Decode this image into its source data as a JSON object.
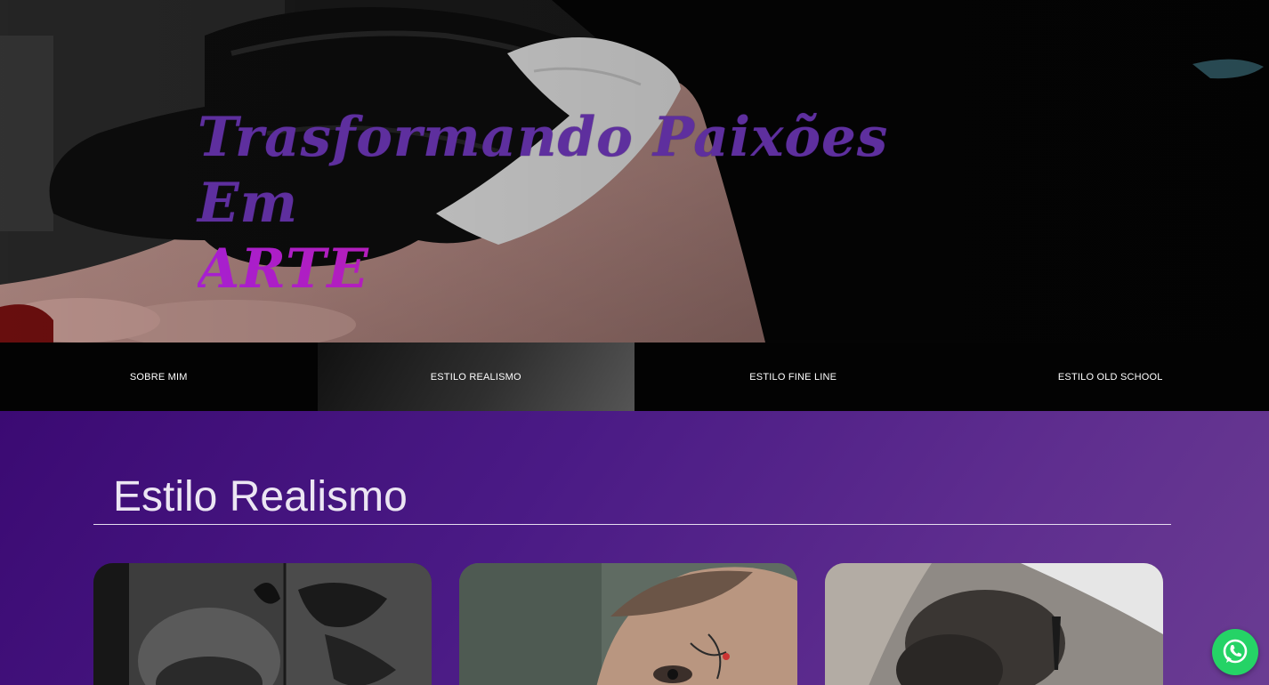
{
  "hero": {
    "title_line1": "Trasformando Paixões Em",
    "title_line2": "ARTE",
    "image": "tattoo-artist-gloved-hand-wiping-skin-photo"
  },
  "tabs": [
    {
      "label": "SOBRE MIM",
      "active": false
    },
    {
      "label": "ESTILO REALISMO",
      "active": true
    },
    {
      "label": "ESTILO FINE LINE",
      "active": false
    },
    {
      "label": "ESTILO OLD SCHOOL",
      "active": false
    }
  ],
  "section": {
    "title": "Estilo Realismo"
  },
  "gallery": [
    {
      "image": "realism-tattoo-butterfly-face-arm"
    },
    {
      "image": "realism-tattoo-woman-face-mandala"
    },
    {
      "image": "realism-tattoo-dark-shading-arm"
    }
  ],
  "floating": {
    "icon": "whatsapp-icon"
  },
  "colors": {
    "title_primary": "#5e2f9e",
    "title_accent": "#c21a92",
    "section_bg": "#4a1a85",
    "whatsapp": "#25d366"
  }
}
